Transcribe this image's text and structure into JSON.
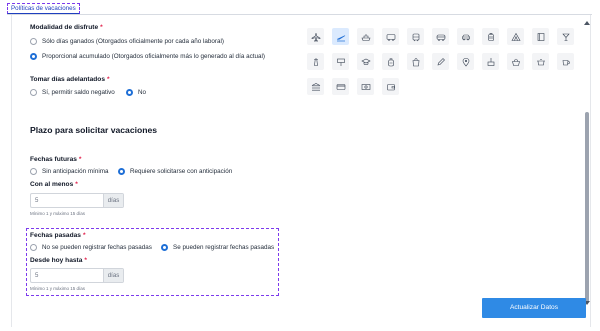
{
  "tab": {
    "label": "Políticas de vacaciones"
  },
  "modalidad": {
    "label": "Modalidad de disfrute",
    "options": [
      {
        "label": "Sólo días ganados (Otorgados oficialmente por cada año laboral)",
        "selected": false
      },
      {
        "label": "Proporcional acumulado (Otorgados oficialmente más lo generado al día actual)",
        "selected": true
      }
    ]
  },
  "adelantados": {
    "label": "Tomar días adelantados",
    "options": [
      {
        "label": "Sí, permitir saldo negativo",
        "selected": false
      },
      {
        "label": "No",
        "selected": true
      }
    ]
  },
  "section_title": "Plazo para solicitar vacaciones",
  "futuras": {
    "label": "Fechas futuras",
    "options": [
      {
        "label": "Sin anticipación mínima",
        "selected": false
      },
      {
        "label": "Requiere solicitarse con anticipación",
        "selected": true
      }
    ],
    "field_label": "Con al menos",
    "value": "5",
    "unit": "días",
    "hint": "Mínimo 1 y máximo 15 días"
  },
  "pasadas": {
    "label": "Fechas pasadas",
    "options": [
      {
        "label": "No se pueden registrar fechas pasadas",
        "selected": false
      },
      {
        "label": "Se pueden registrar fechas pasadas",
        "selected": true
      }
    ],
    "field_label": "Desde hoy hasta",
    "value": "5",
    "unit": "días",
    "hint": "Mínimo 1 y máximo 15 días"
  },
  "icons": [
    "plane-icon",
    "airplane-takeoff-icon",
    "ship-icon",
    "bus-icon",
    "tram-icon",
    "train-icon",
    "car-icon",
    "luggage-icon",
    "tent-icon",
    "book-icon",
    "cocktail-icon",
    "lighthouse-icon",
    "sign-icon",
    "graduation-cap-icon",
    "backpack-icon",
    "shopping-bag-icon",
    "pencil-icon",
    "map-pin-icon",
    "cake-icon",
    "basket-icon",
    "pot-icon",
    "coffee-icon",
    "bank-icon",
    "card-icon",
    "money-icon",
    "wallet-icon"
  ],
  "selected_icon": "airplane-takeoff-icon",
  "submit": {
    "label": "Actualizar Datos"
  },
  "colors": {
    "accent": "#2f8ae5",
    "required": "#e11d48"
  }
}
